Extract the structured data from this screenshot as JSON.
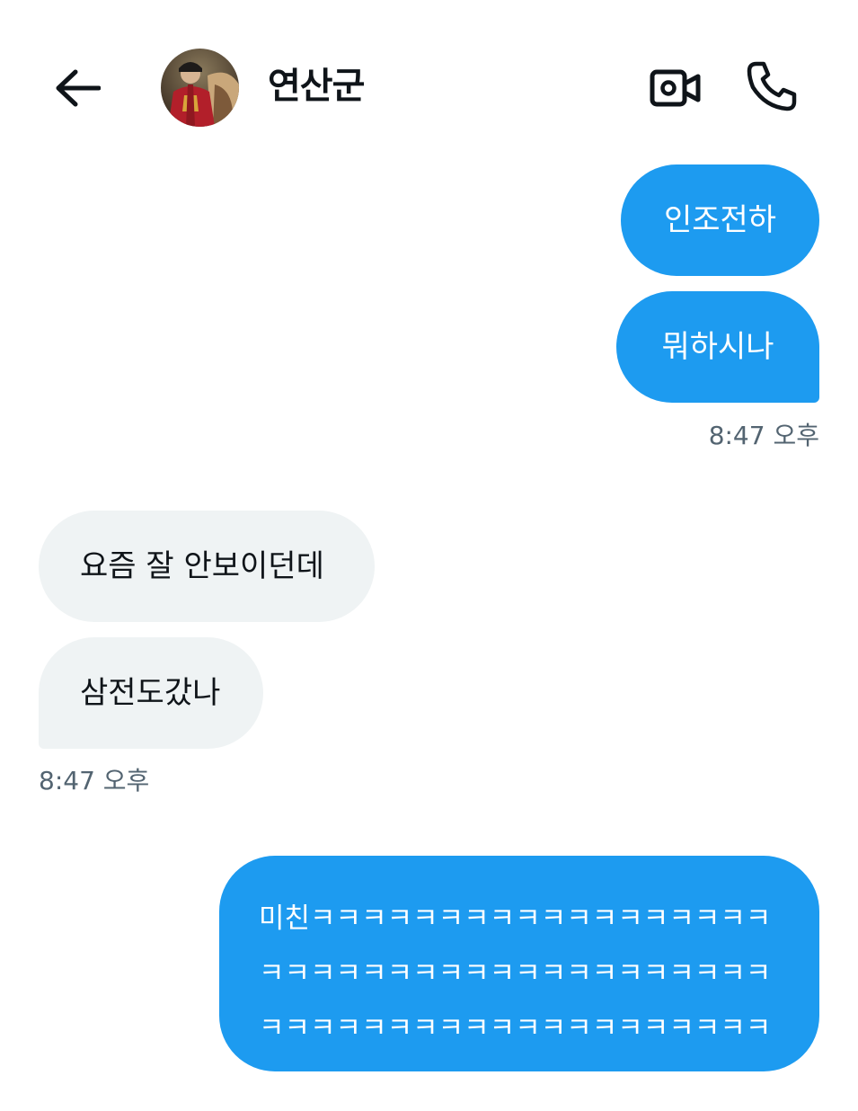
{
  "header": {
    "contact_name": "연산군",
    "back_icon": "arrow-left-icon",
    "video_icon": "video-camera-icon",
    "call_icon": "phone-icon"
  },
  "messages": [
    {
      "direction": "sent",
      "text": "인조전하"
    },
    {
      "direction": "sent",
      "text": "뭐하시나",
      "time": "8:47 오후"
    },
    {
      "direction": "received",
      "text": "요즘 잘 안보이던데"
    },
    {
      "direction": "received",
      "text": "삼전도갔나",
      "time": "8:47 오후"
    },
    {
      "direction": "sent",
      "text": "미친ㅋㅋㅋㅋㅋㅋㅋㅋㅋㅋㅋㅋㅋㅋㅋㅋㅋㅋㅋㅋㅋㅋㅋㅋㅋㅋㅋㅋㅋㅋㅋㅋㅋㅋㅋㅋㅋㅋㅋㅋㅋㅋㅋㅋㅋㅋㅋㅋㅋㅋㅋㅋㅋㅋㅋㅋㅋㅋㅋㅋㅋㅋㅋ"
    }
  ],
  "colors": {
    "sent_bubble": "#1d9bf0",
    "received_bubble": "#eff3f4",
    "timestamp": "#536471"
  }
}
